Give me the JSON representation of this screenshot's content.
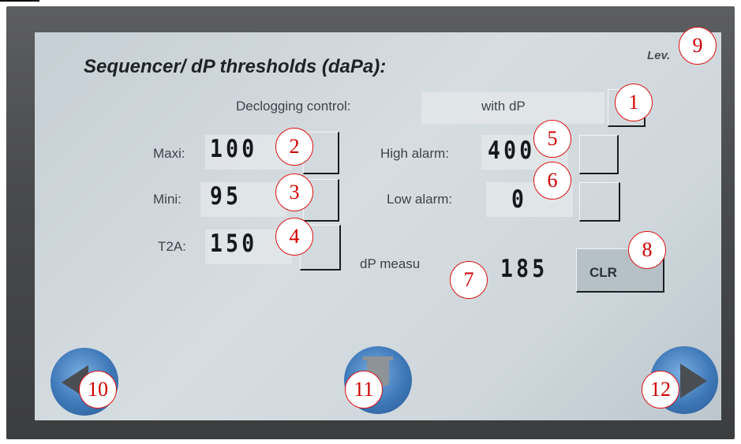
{
  "header": {
    "title": "Sequencer/ dP thresholds (daPa):",
    "level_label": "Lev."
  },
  "declogging": {
    "label": "Declogging control:",
    "value": "with dP"
  },
  "thresholds": {
    "maxi": {
      "label": "Maxi:",
      "value": "100"
    },
    "mini": {
      "label": "Mini:",
      "value": "95"
    },
    "t2a": {
      "label": "T2A:",
      "value": "150"
    }
  },
  "alarms": {
    "high": {
      "label": "High alarm:",
      "value": "400"
    },
    "low": {
      "label": "Low alarm:",
      "value": "0"
    }
  },
  "measure": {
    "label": "dP measu",
    "value": "185",
    "clear_label": "CLR"
  },
  "nav": {
    "prev_icon": "left-arrow-icon",
    "delete_icon": "trash-icon",
    "next_icon": "right-arrow-icon"
  },
  "callouts": [
    "1",
    "2",
    "3",
    "4",
    "5",
    "6",
    "7",
    "8",
    "9",
    "10",
    "11",
    "12"
  ],
  "colors": {
    "callout": "#d00000",
    "nav_button": "#3e78b8",
    "screen": "#d0d8dd"
  }
}
